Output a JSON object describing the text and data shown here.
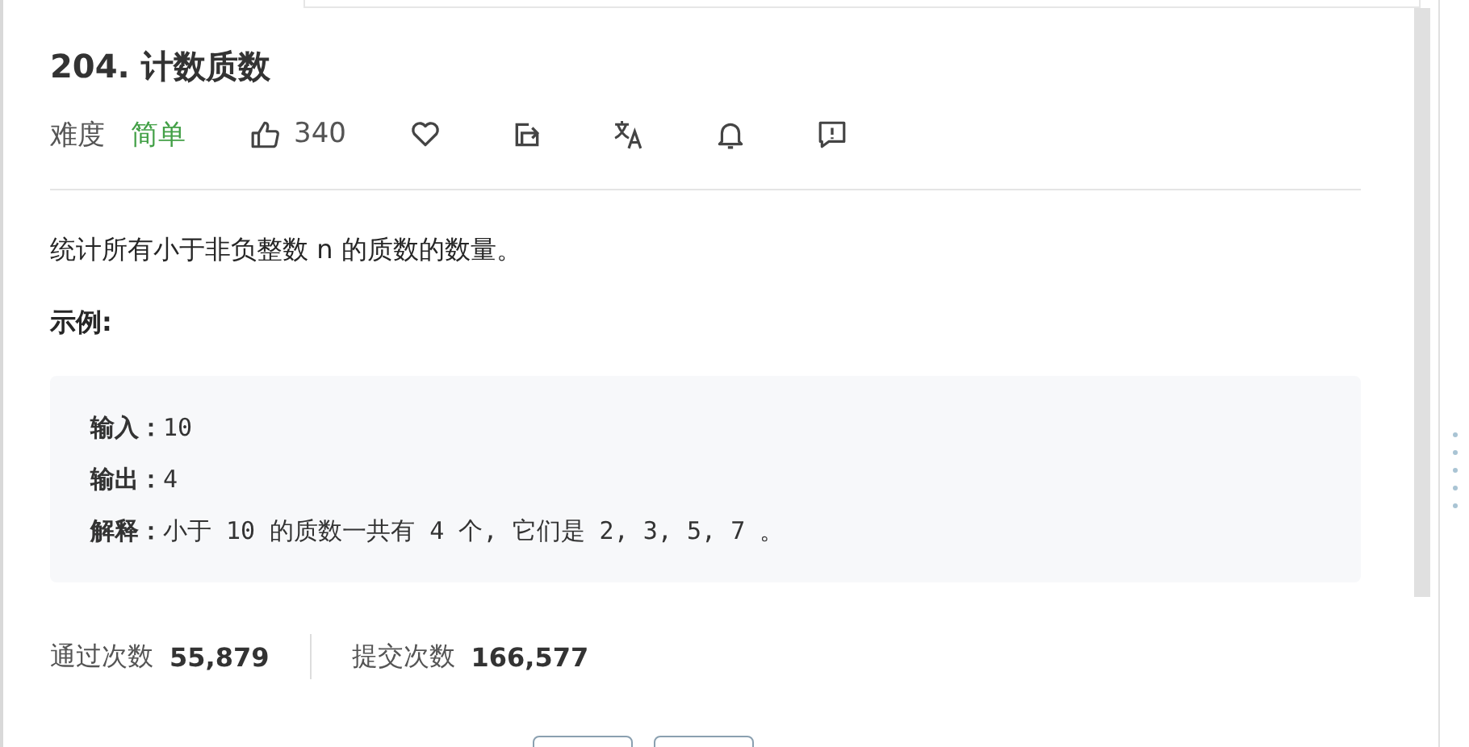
{
  "problem": {
    "title": "204. 计数质数",
    "difficulty_label": "难度",
    "difficulty": "简单",
    "likes": "340",
    "actions": [
      {
        "kind": "favorite"
      },
      {
        "kind": "share"
      },
      {
        "kind": "translate"
      },
      {
        "kind": "notify"
      },
      {
        "kind": "feedback"
      }
    ],
    "description": "统计所有小于非负整数 n 的质数的数量。",
    "example_heading": "示例:",
    "example_lines": [
      {
        "label": "输入：",
        "value": "10"
      },
      {
        "label": "输出：",
        "value": "4"
      },
      {
        "label": "解释：",
        "value": "小于 10 的质数一共有 4 个, 它们是 2, 3, 5, 7 。"
      }
    ],
    "stats": [
      {
        "label": "通过次数",
        "value": "55,879"
      },
      {
        "label": "提交次数",
        "value": "166,577"
      }
    ]
  }
}
